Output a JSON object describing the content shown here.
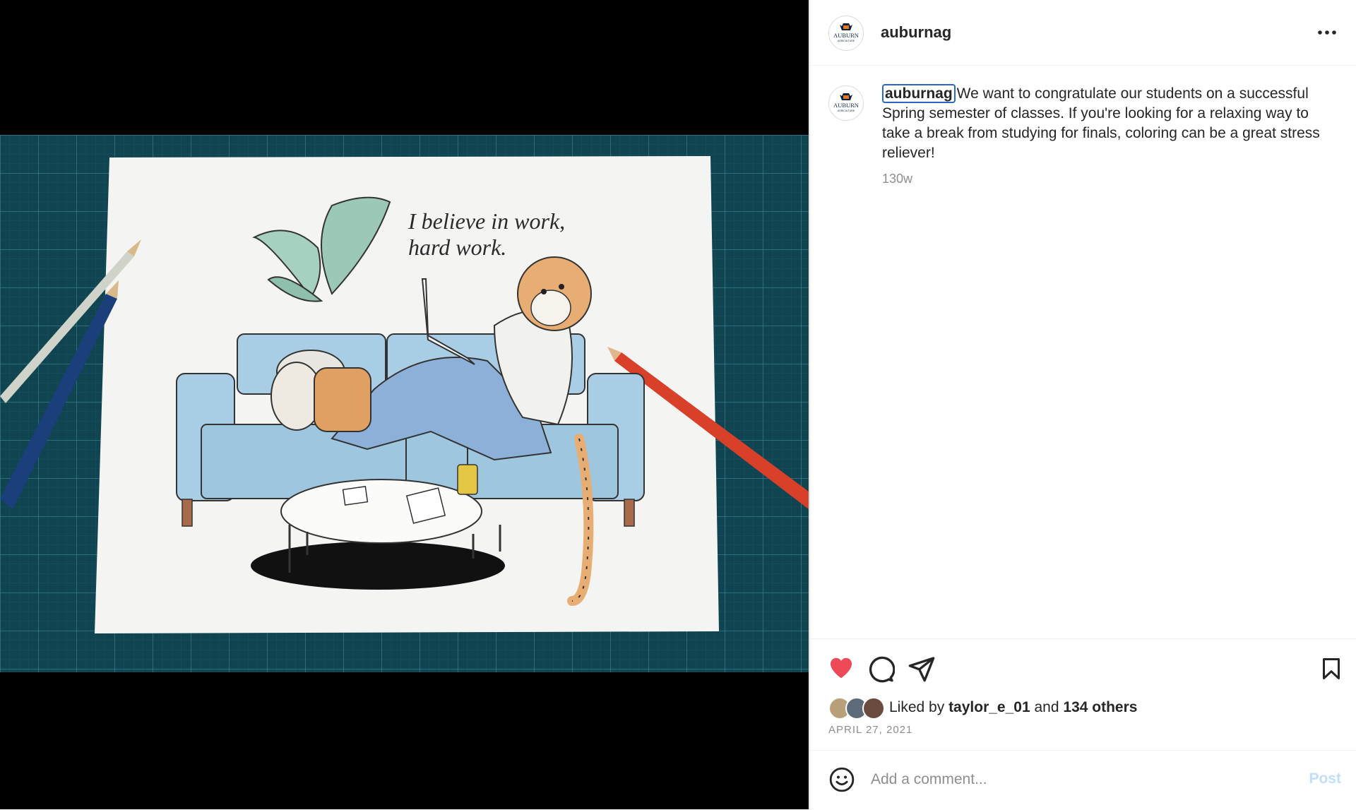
{
  "post": {
    "username": "auburnag",
    "avatar_logo": "AUBURN",
    "avatar_sub": "AGRICULTURE",
    "more_icon": "more-horizontal-icon",
    "image": {
      "quote_line1": "I believe in work,",
      "quote_line2": "hard work."
    },
    "caption": {
      "username": "auburnag",
      "text": "We want to congratulate our students on a successful Spring semester of classes. If you're looking for a relaxing way to take a break from studying for finals, coloring can be a great stress reliever!",
      "time": "130w"
    },
    "actions": {
      "like_icon": "heart-filled-icon",
      "comment_icon": "comment-icon",
      "share_icon": "send-icon",
      "save_icon": "bookmark-icon",
      "like_color": "#ed4956"
    },
    "likes": {
      "prefix": "Liked by",
      "user": "taylor_e_01",
      "and": "and",
      "others": "134 others"
    },
    "date": "APRIL 27, 2021",
    "comment": {
      "placeholder": "Add a comment...",
      "post_label": "Post"
    }
  }
}
